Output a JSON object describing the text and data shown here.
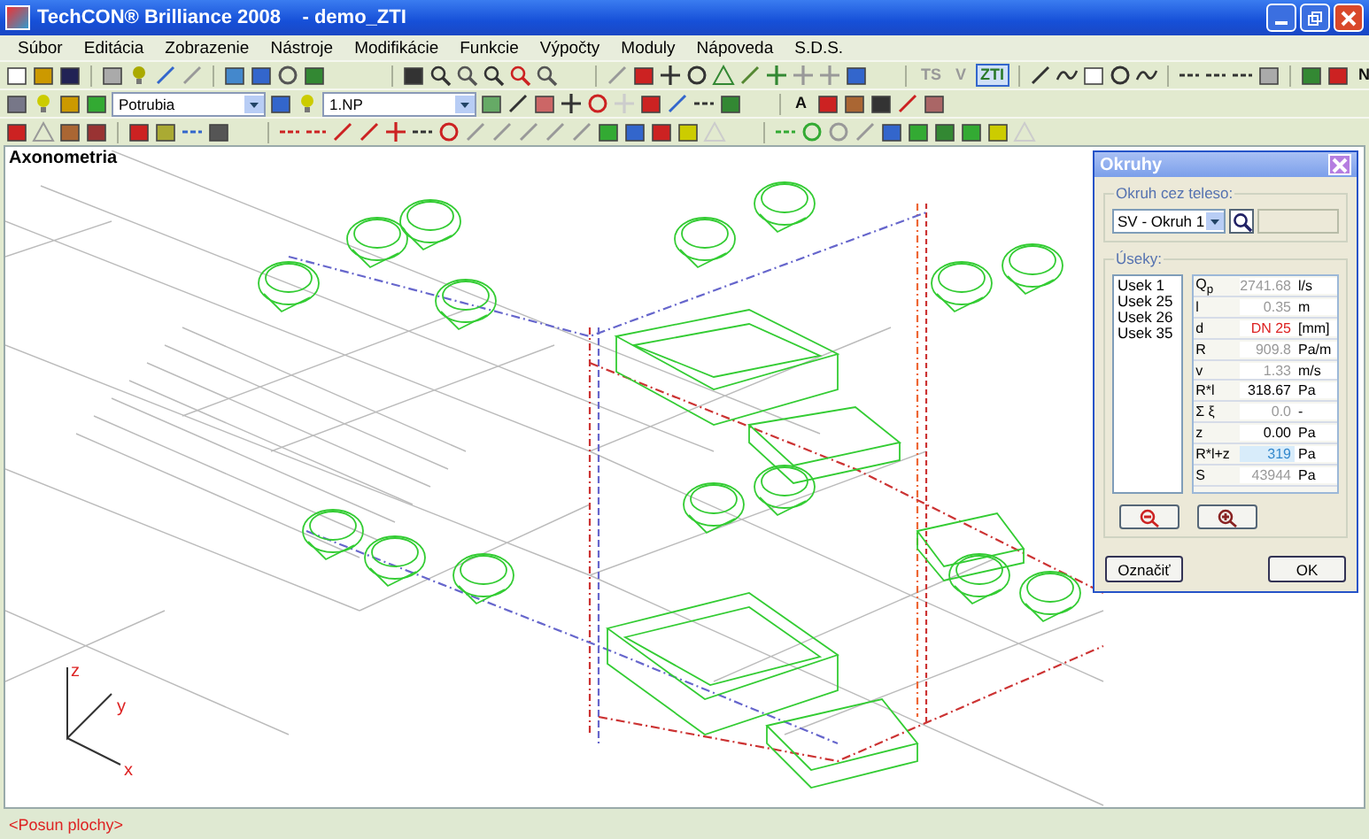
{
  "window": {
    "title": "TechCON® Brilliance 2008    - demo_ZTI"
  },
  "menu": [
    "Súbor",
    "Editácia",
    "Zobrazenie",
    "Nástroje",
    "Modifikácie",
    "Funkcie",
    "Výpočty",
    "Moduly",
    "Nápoveda",
    "S.D.S."
  ],
  "toolbar_texts": [
    {
      "label": "TS",
      "selected": false,
      "disabled": true
    },
    {
      "label": "V",
      "selected": false,
      "disabled": true
    },
    {
      "label": "ZTI",
      "selected": true,
      "disabled": false
    },
    {
      "label": "N",
      "selected": false,
      "disabled": false
    },
    {
      "label": "A",
      "selected": false,
      "disabled": false
    }
  ],
  "toolbar_combos": [
    {
      "value": "Potrubia"
    },
    {
      "value": "1.NP"
    }
  ],
  "canvas": {
    "view_label": "Axonometria",
    "axes": [
      "z",
      "y",
      "x"
    ]
  },
  "dialog": {
    "title": "Okruhy",
    "circuit_group": "Okruh cez teleso:",
    "circuit": "SV - Okruh 1",
    "sections_group": "Úseky:",
    "sections": [
      {
        "label": "Usek 1",
        "selected": false
      },
      {
        "label": "Usek 25",
        "selected": false
      },
      {
        "label": "Usek 26",
        "selected": false
      },
      {
        "label": "Usek 35",
        "selected": false
      }
    ],
    "values": [
      {
        "symbol": "Q$_{p}$",
        "value": "2741.68",
        "unit": "l/s",
        "kind": "computed"
      },
      {
        "symbol": "l",
        "value": "0.35",
        "unit": "m",
        "kind": "computed"
      },
      {
        "symbol": "d",
        "value": "DN 25",
        "unit": "[mm]",
        "kind": "warning"
      },
      {
        "symbol": "R",
        "value": "909.8",
        "unit": "Pa/m",
        "kind": "computed"
      },
      {
        "symbol": "v",
        "value": "1.33",
        "unit": "m/s",
        "kind": "computed"
      },
      {
        "symbol": "R*l",
        "value": "318.67",
        "unit": "Pa",
        "kind": "result"
      },
      {
        "symbol": "Σ ξ",
        "value": "0.0",
        "unit": "-",
        "kind": "computed"
      },
      {
        "symbol": "z",
        "value": "0.00",
        "unit": "Pa",
        "kind": "result"
      },
      {
        "symbol": "R*l+z",
        "value": "319",
        "unit": "Pa",
        "kind": "highlight"
      },
      {
        "symbol": "S",
        "value": "43944",
        "unit": "Pa",
        "kind": "computed"
      }
    ],
    "buttons": [
      "Označiť",
      "OK"
    ]
  },
  "status_bar": "<Posun plochy>"
}
